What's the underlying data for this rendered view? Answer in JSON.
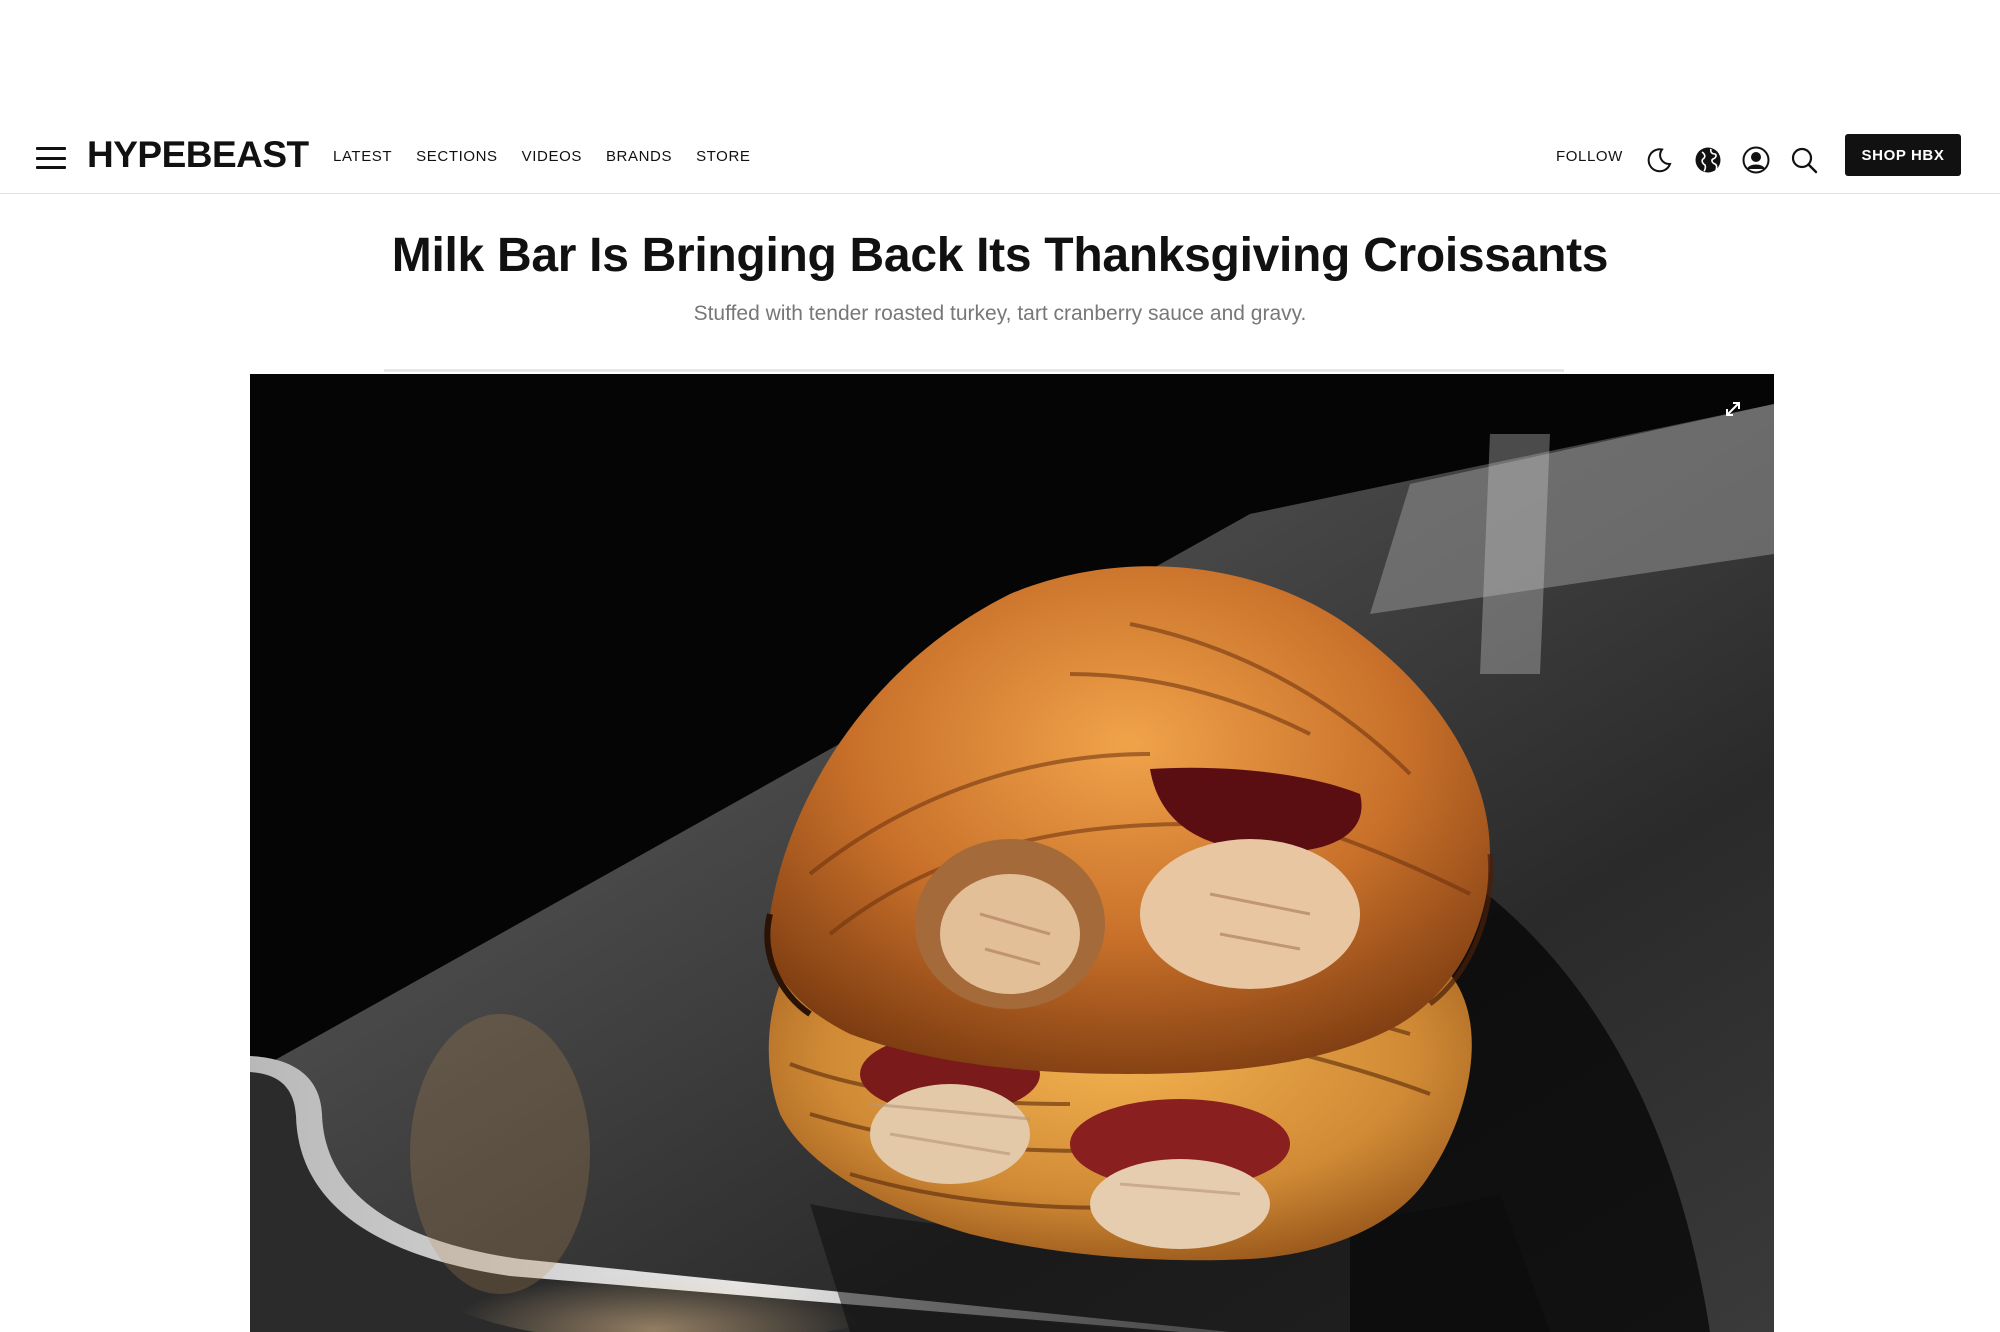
{
  "header": {
    "logo": "HYPEBEAST",
    "nav": [
      "LATEST",
      "SECTIONS",
      "VIDEOS",
      "BRANDS",
      "STORE"
    ],
    "follow_label": "FOLLOW",
    "shop_label": "SHOP HBX",
    "icons": [
      "menu-icon",
      "moon-icon",
      "globe-icon",
      "user-icon",
      "search-icon"
    ]
  },
  "article": {
    "title": "Milk Bar Is Bringing Back Its Thanksgiving Croissants",
    "subtitle": "Stuffed with tender roasted turkey, tart cranberry sauce and gravy."
  },
  "hero": {
    "icons": [
      "expand-icon"
    ]
  },
  "colors": {
    "text": "#111111",
    "subtitle": "#777777",
    "button_bg": "#111111",
    "button_text": "#ffffff",
    "divider": "#e6e6e6"
  }
}
